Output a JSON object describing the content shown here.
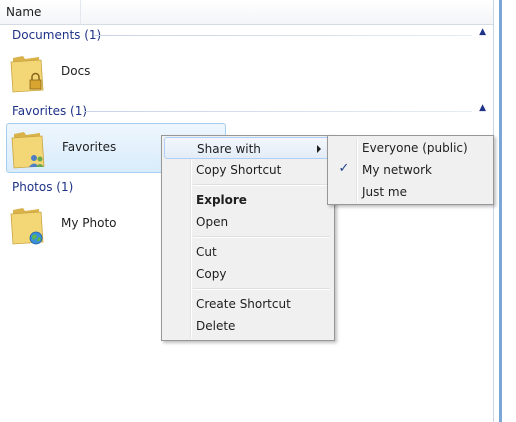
{
  "header": {
    "column_name": "Name"
  },
  "groups": [
    {
      "label": "Documents (1)",
      "items": [
        {
          "label": "Docs",
          "icon": "folder-lock-icon"
        }
      ]
    },
    {
      "label": "Favorites (1)",
      "items": [
        {
          "label": "Favorites",
          "icon": "folder-people-icon",
          "selected": true
        }
      ]
    },
    {
      "label": "Photos (1)",
      "items": [
        {
          "label": "My Photo",
          "icon": "folder-globe-icon"
        }
      ]
    }
  ],
  "context_menu": {
    "items": [
      {
        "label": "Share with",
        "has_submenu": true,
        "highlighted": true
      },
      {
        "label": "Copy Shortcut"
      },
      {
        "label": "Explore",
        "bold": true
      },
      {
        "label": "Open"
      },
      {
        "label": "Cut"
      },
      {
        "label": "Copy"
      },
      {
        "label": "Create Shortcut"
      },
      {
        "label": "Delete"
      }
    ]
  },
  "submenu": {
    "items": [
      {
        "label": "Everyone (public)",
        "checked": false
      },
      {
        "label": "My network",
        "checked": true
      },
      {
        "label": "Just me",
        "checked": false
      }
    ],
    "check_glyph": "✓"
  },
  "colors": {
    "group_header": "#1e3287",
    "selection_bg": "#d9ecfb",
    "selection_border": "#a7cdf0",
    "menu_bg": "#f0f0f0",
    "pane_border": "#7ba7d6"
  }
}
